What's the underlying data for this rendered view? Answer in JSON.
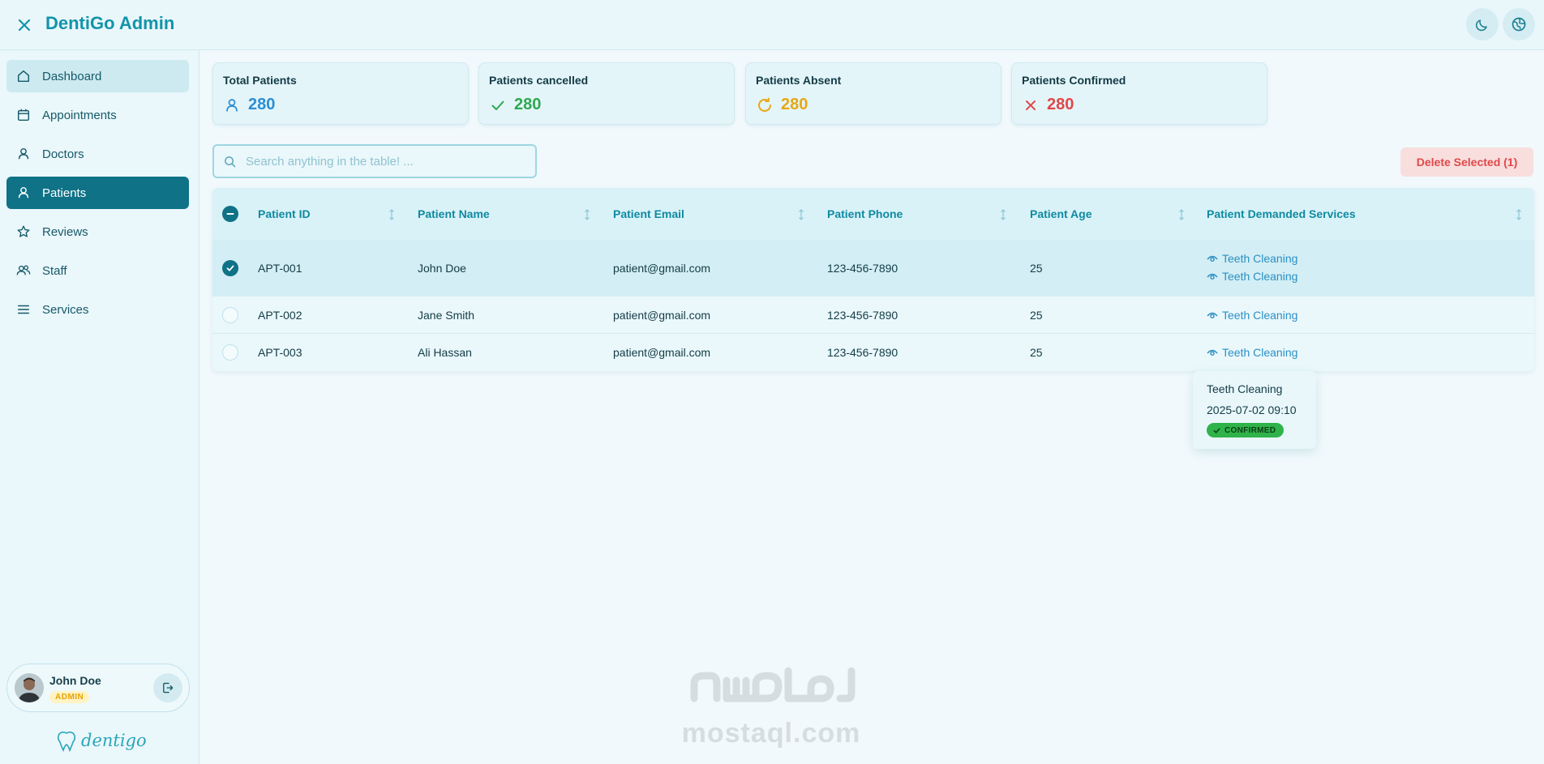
{
  "header": {
    "title": "DentiGo Admin",
    "icons": [
      "close-icon",
      "moon-icon",
      "globe-icon"
    ]
  },
  "sidebar": {
    "items": [
      {
        "label": "Dashboard",
        "icon": "home-icon",
        "state": "hover"
      },
      {
        "label": "Appointments",
        "icon": "calendar-icon",
        "state": "normal"
      },
      {
        "label": "Doctors",
        "icon": "user-icon",
        "state": "normal"
      },
      {
        "label": "Patients",
        "icon": "user-icon",
        "state": "active"
      },
      {
        "label": "Reviews",
        "icon": "star-icon",
        "state": "normal"
      },
      {
        "label": "Staff",
        "icon": "users-icon",
        "state": "normal"
      },
      {
        "label": "Services",
        "icon": "list-icon",
        "state": "normal"
      }
    ],
    "user": {
      "name": "John Doe",
      "role": "ADMIN"
    },
    "logo_text": "dentigo"
  },
  "stats": [
    {
      "title": "Total Patients",
      "value": "280",
      "icon": "user-icon",
      "color": "#2b8fd4"
    },
    {
      "title": "Patients cancelled",
      "value": "280",
      "icon": "check-icon",
      "color": "#2fa84f"
    },
    {
      "title": "Patients Absent",
      "value": "280",
      "icon": "refresh-icon",
      "color": "#e6a817"
    },
    {
      "title": "Patients Confirmed",
      "value": "280",
      "icon": "x-icon",
      "color": "#e04848"
    }
  ],
  "search": {
    "placeholder": "Search anything in the table! ..."
  },
  "toolbar": {
    "delete_label": "Delete Selected (1)"
  },
  "table": {
    "columns": [
      "Patient ID",
      "Patient Name",
      "Patient Email",
      "Patient Phone",
      "Patient Age",
      "Patient Demanded Services"
    ],
    "rows": [
      {
        "id": "APT-001",
        "name": "John Doe",
        "email": "patient@gmail.com",
        "phone": "123-456-7890",
        "age": "25",
        "services": [
          "Teeth Cleaning",
          "Teeth Cleaning"
        ],
        "selected": true
      },
      {
        "id": "APT-002",
        "name": "Jane Smith",
        "email": "patient@gmail.com",
        "phone": "123-456-7890",
        "age": "25",
        "services": [
          "Teeth Cleaning"
        ],
        "selected": false
      },
      {
        "id": "APT-003",
        "name": "Ali Hassan",
        "email": "patient@gmail.com",
        "phone": "123-456-7890",
        "age": "25",
        "services": [
          "Teeth Cleaning"
        ],
        "selected": false
      }
    ]
  },
  "tooltip": {
    "title": "Teeth Cleaning",
    "datetime": "2025-07-02 09:10",
    "status": "CONFIRMED",
    "status_color": "#2fb34a"
  },
  "watermark": {
    "latin": "mostaql.com"
  },
  "colors": {
    "primary": "#0f7287",
    "accent": "#1294a9",
    "danger": "#e04848"
  }
}
